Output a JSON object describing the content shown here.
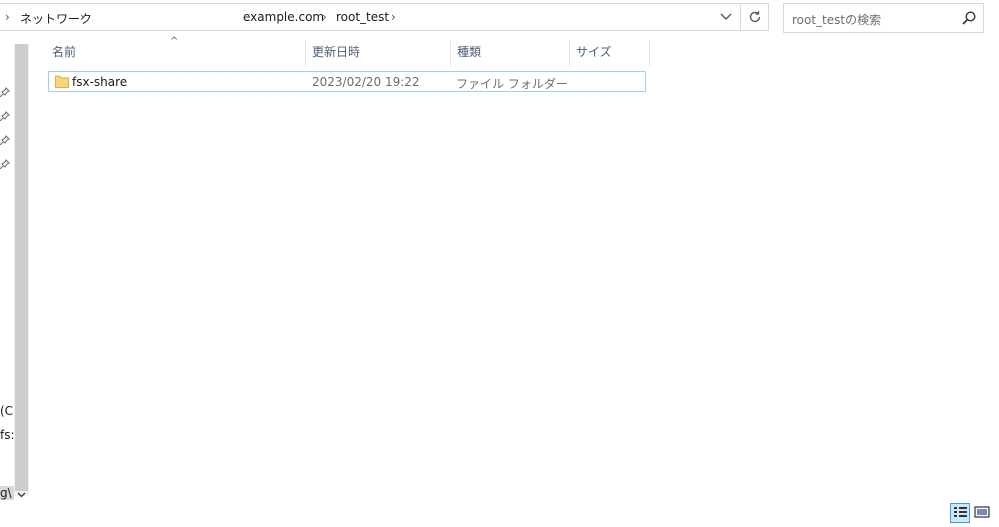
{
  "address_bar": {
    "breadcrumbs": [
      "ネットワーク",
      "example.com",
      "root_test"
    ]
  },
  "search": {
    "placeholder": "root_testの検索"
  },
  "nav_pane": {
    "partial_labels": [
      "(C",
      "fs:",
      "g\\"
    ]
  },
  "columns": [
    "名前",
    "更新日時",
    "種類",
    "サイズ"
  ],
  "files": [
    {
      "name": "fsx-share",
      "modified": "2023/02/20 19:22",
      "type": "ファイル フォルダー",
      "size": "",
      "icon": "folder-icon"
    }
  ],
  "colors": {
    "selection_border": "#99d1ff",
    "header_text": "#4c607a",
    "folder_yellow": "#f8d775"
  }
}
